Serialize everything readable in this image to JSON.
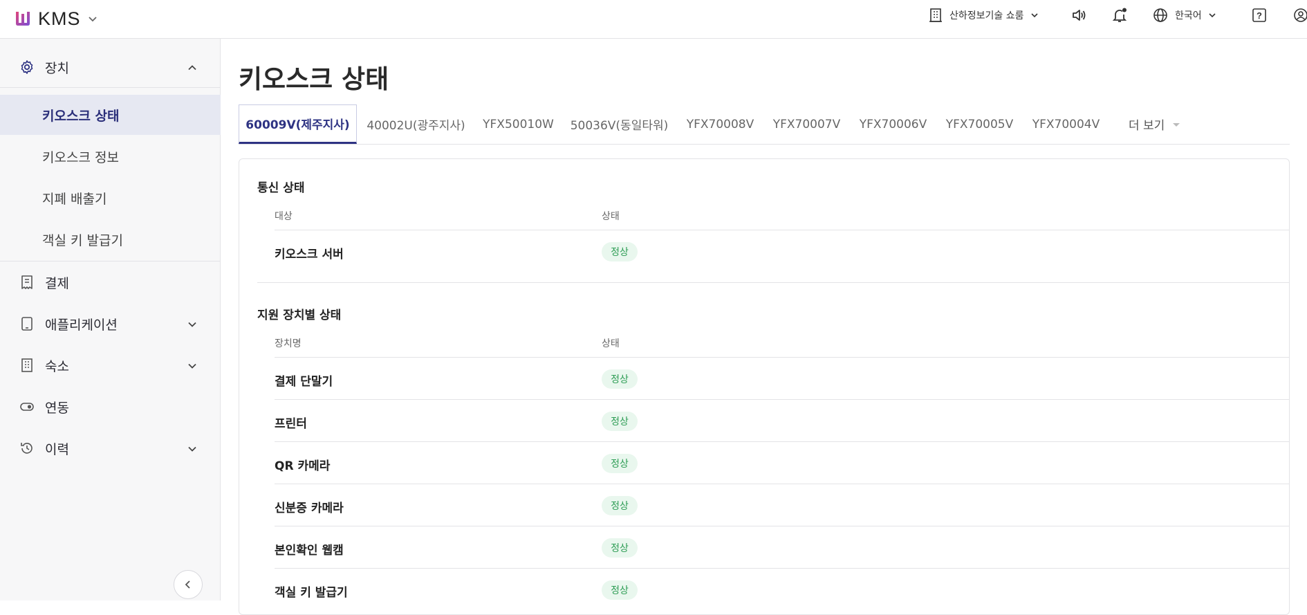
{
  "header": {
    "app_name": "KMS",
    "org_name": "산하정보기술 쇼룸",
    "language": "한국어",
    "icons": [
      "speaker-icon",
      "bell-icon",
      "globe-icon",
      "help-icon",
      "user-icon"
    ]
  },
  "sidebar": {
    "groups": [
      {
        "label": "장치",
        "icon": "gear-icon",
        "expanded": true,
        "items": [
          {
            "label": "키오스크 상태",
            "active": true
          },
          {
            "label": "키오스크 정보"
          },
          {
            "label": "지폐 배출기"
          },
          {
            "label": "객실 키 발급기"
          }
        ]
      },
      {
        "label": "결제",
        "icon": "receipt-icon"
      },
      {
        "label": "애플리케이션",
        "icon": "tablet-icon",
        "has_children": true
      },
      {
        "label": "숙소",
        "icon": "building-icon",
        "has_children": true
      },
      {
        "label": "연동",
        "icon": "toggle-icon"
      },
      {
        "label": "이력",
        "icon": "history-icon",
        "has_children": true
      }
    ]
  },
  "page": {
    "title": "키오스크 상태",
    "tabs": [
      "60009V(제주지사)",
      "40002U(광주지사)",
      "YFX50010W",
      "50036V(동일타워)",
      "YFX70008V",
      "YFX70007V",
      "YFX70006V",
      "YFX70005V",
      "YFX70004V"
    ],
    "more_label": "더 보기"
  },
  "comm": {
    "title": "통신 상태",
    "col_target": "대상",
    "col_status": "상태",
    "rows": [
      {
        "name": "키오스크 서버",
        "status": "정상"
      }
    ]
  },
  "devices": {
    "title": "지원 장치별 상태",
    "col_name": "장치명",
    "col_status": "상태",
    "rows": [
      {
        "name": "결제 단말기",
        "status": "정상"
      },
      {
        "name": "프린터",
        "status": "정상"
      },
      {
        "name": "QR 카메라",
        "status": "정상"
      },
      {
        "name": "신분증 카메라",
        "status": "정상"
      },
      {
        "name": "본인확인 웹캠",
        "status": "정상"
      },
      {
        "name": "객실 키 발급기",
        "status": "정상"
      }
    ]
  },
  "colors": {
    "brand": "#2e3383",
    "ok_bg": "#e9f7ee",
    "ok_text": "#2e9d55",
    "logo_gradient": [
      "#e0457b",
      "#7b4fd6"
    ]
  }
}
